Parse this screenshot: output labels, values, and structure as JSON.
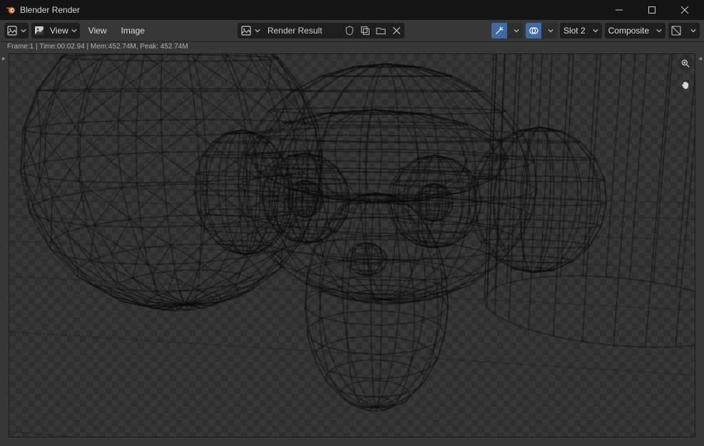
{
  "window": {
    "title": "Blender Render"
  },
  "toolbar": {
    "editor_icon": "image-editor-icon",
    "image_mode_icon": "image-icon",
    "view_menu": "View",
    "view_menu2": "View",
    "image_menu": "Image",
    "image_name": "Render Result",
    "slot": "Slot 2",
    "layer": "Composite"
  },
  "status": {
    "text": "Frame:1 | Time:00:02.94 | Mem:452.74M, Peak: 452.74M"
  },
  "viewport": {
    "zoom_tool": "magnify-icon",
    "pan_tool": "hand-icon"
  }
}
